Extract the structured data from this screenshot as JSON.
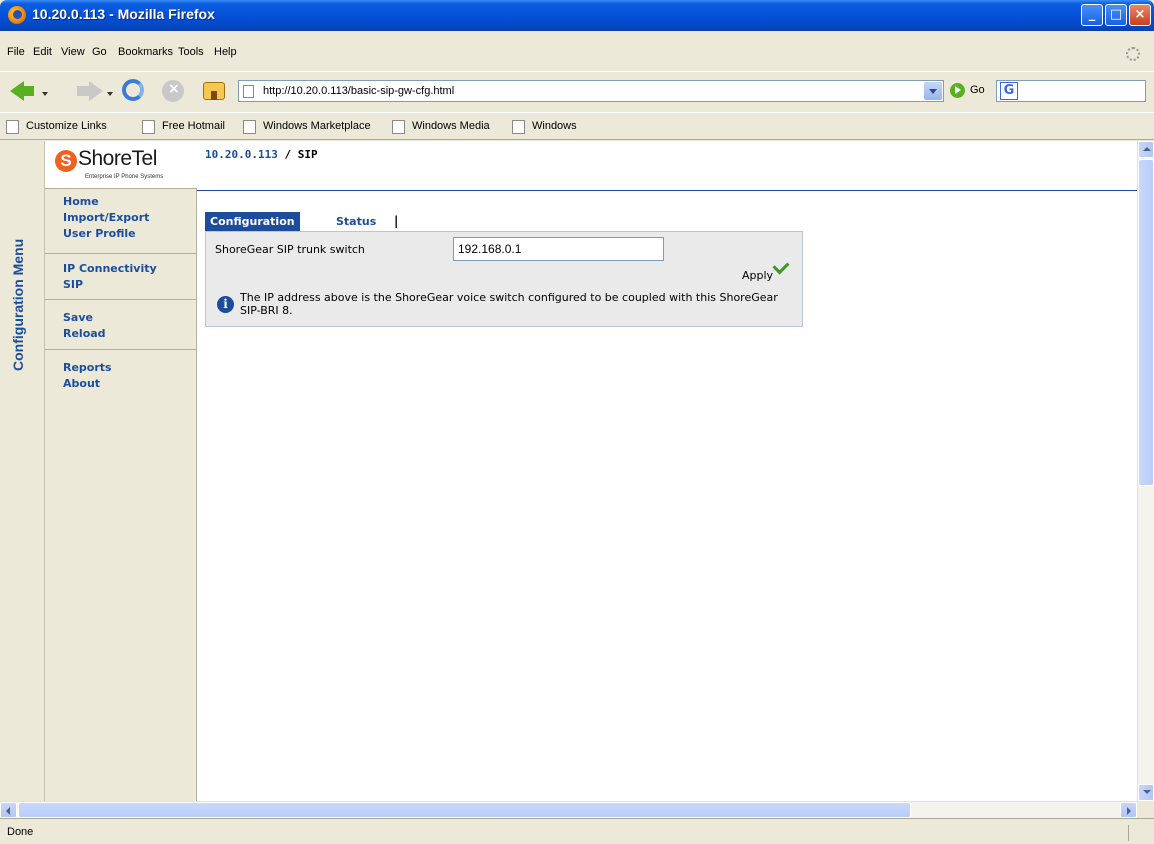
{
  "window": {
    "title": "10.20.0.113 - Mozilla Firefox",
    "min_glyph": "_",
    "max_glyph": "□",
    "close_glyph": "×"
  },
  "menubar": {
    "items": [
      "File",
      "Edit",
      "View",
      "Go",
      "Bookmarks",
      "Tools",
      "Help"
    ]
  },
  "navbar": {
    "url": "http://10.20.0.113/basic-sip-gw-cfg.html",
    "go_label": "Go",
    "search_engine_glyph": "G"
  },
  "bookmarks": {
    "items": [
      "Customize Links",
      "Free Hotmail",
      "Windows Marketplace",
      "Windows Media",
      "Windows"
    ]
  },
  "config_menu": {
    "label": "Configuration Menu"
  },
  "logo": {
    "mark": "S",
    "brand": "ShoreTel",
    "tagline": "Enterprise IP Phone Systems"
  },
  "sidebar": {
    "groups": [
      [
        "Home",
        "Import/Export",
        "User Profile"
      ],
      [
        "IP Connectivity",
        "SIP"
      ],
      [
        "Save",
        "Reload"
      ],
      [
        "Reports",
        "About"
      ]
    ]
  },
  "breadcrumb": {
    "host": "10.20.0.113",
    "separator": "/",
    "current": "SIP"
  },
  "tabs": {
    "active": "Configuration",
    "inactive": "Status",
    "separator": "|"
  },
  "form": {
    "field_label": "ShoreGear SIP trunk switch",
    "field_value": "192.168.0.1",
    "apply_label": "Apply",
    "info_glyph": "i",
    "info_text": "The IP address above is the ShoreGear voice switch configured to be coupled with this ShoreGear SIP-BRI 8."
  },
  "status": {
    "text": "Done"
  },
  "colors": {
    "link_blue": "#1b4d9c",
    "titlebar_blue": "#0651d8",
    "apply_green": "#3a9a20",
    "logo_orange": "#f06020"
  }
}
